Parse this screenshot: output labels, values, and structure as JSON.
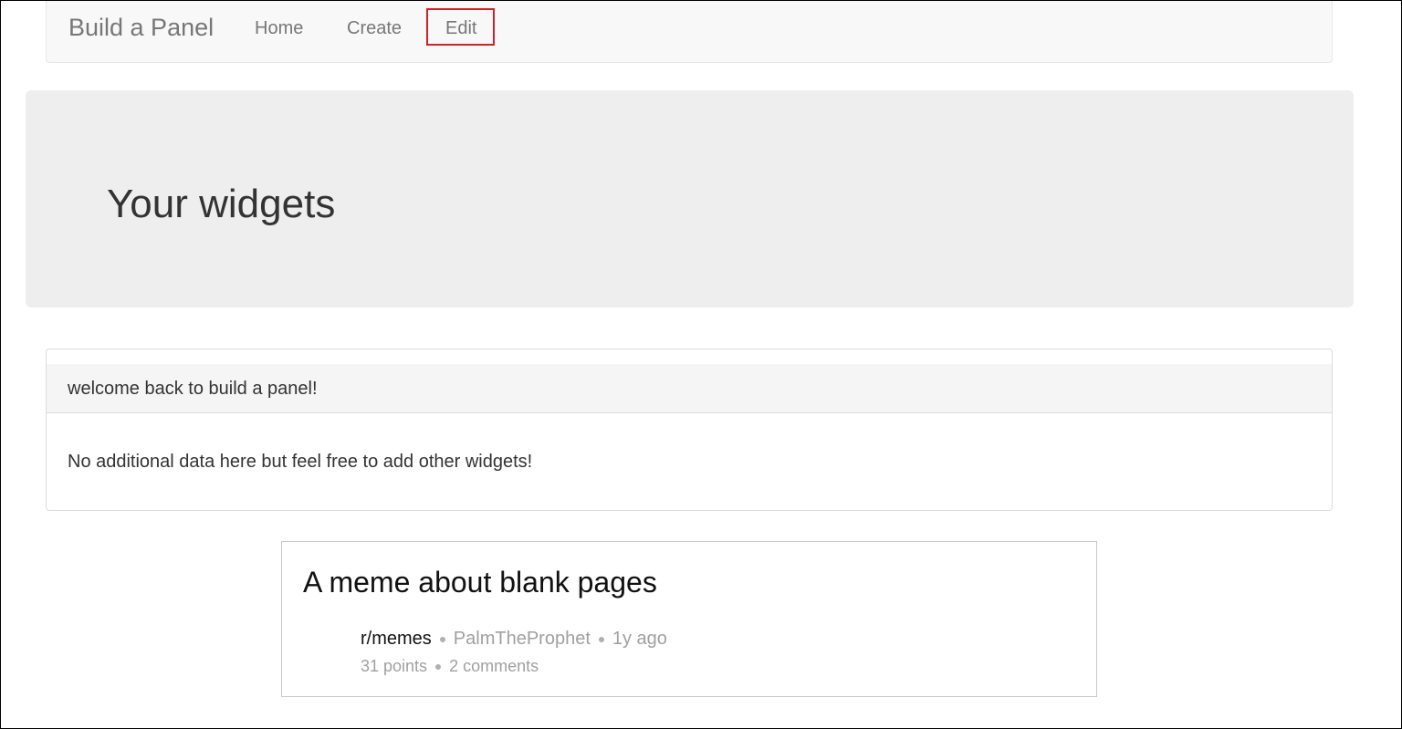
{
  "navbar": {
    "brand": "Build a Panel",
    "items": [
      {
        "label": "Home"
      },
      {
        "label": "Create"
      },
      {
        "label": "Edit",
        "highlight_color": "#d0202a"
      }
    ]
  },
  "jumbotron": {
    "title": "Your widgets"
  },
  "panel": {
    "heading": "welcome back to build a panel!",
    "body": "No additional data here but feel free to add other widgets!"
  },
  "reddit_card": {
    "title": "A meme about blank pages",
    "subreddit": "r/memes",
    "author": "PalmTheProphet",
    "age": "1y ago",
    "points": "31 points",
    "comments": "2 comments"
  }
}
